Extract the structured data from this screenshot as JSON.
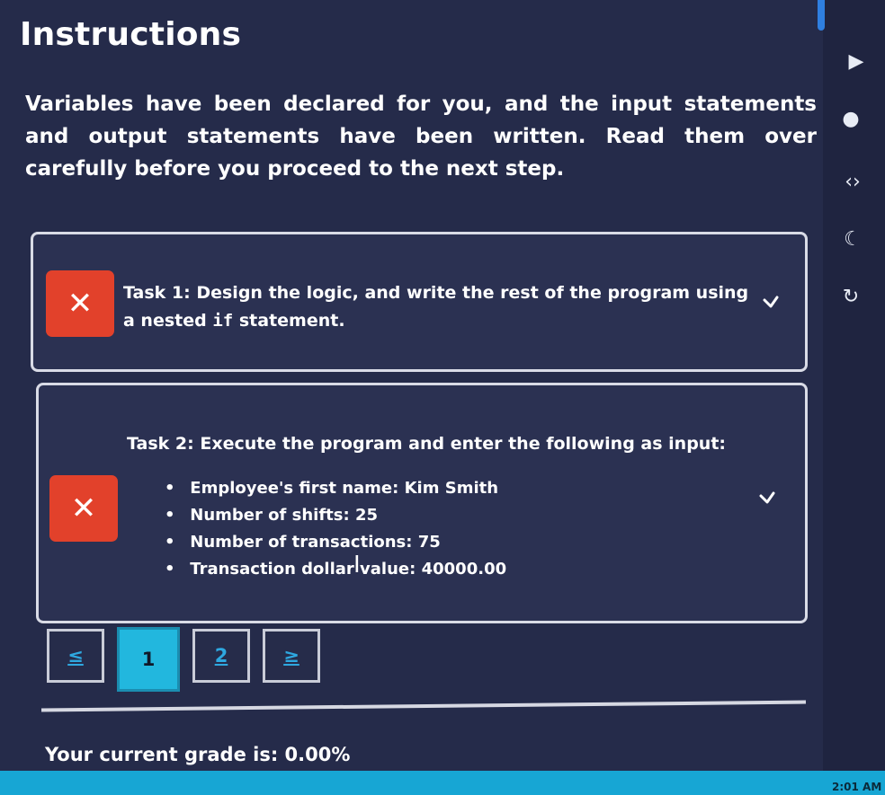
{
  "panel": {
    "title": "Instructions",
    "intro": "Variables have been declared for you, and the input statements and output statements have been written. Read them over carefully before you proceed to the next step."
  },
  "tasks": [
    {
      "status_icon": "close-icon",
      "status_glyph": "✕",
      "label": "Task 1:",
      "text_before": "Design the logic, and write the rest of the program using a nested",
      "code": "if",
      "text_after": "statement.",
      "expand_icon": "chevron-down-icon"
    },
    {
      "status_icon": "close-icon",
      "status_glyph": "✕",
      "label": "Task 2:",
      "text": "Execute the program and enter the following as input:",
      "items": [
        {
          "label": "Employee's first name:",
          "value": "Kim Smith"
        },
        {
          "label": "Number of shifts:",
          "value": "25"
        },
        {
          "label": "Number of transactions:",
          "value": "75"
        },
        {
          "label": "Transaction dollar value:",
          "value": "40000.00"
        }
      ],
      "expand_icon": "chevron-down-icon"
    }
  ],
  "pagination": {
    "prev": "≤",
    "pages": [
      "1",
      "2"
    ],
    "current": "1",
    "next": "≥"
  },
  "grade": {
    "label": "Your current grade is:",
    "value": "0.00%"
  },
  "taskbar": {
    "time": "2:01 AM"
  },
  "colors": {
    "background": "#252b4a",
    "error": "#e2412b",
    "active_page": "#22b7de",
    "link": "#2ea8e0"
  }
}
